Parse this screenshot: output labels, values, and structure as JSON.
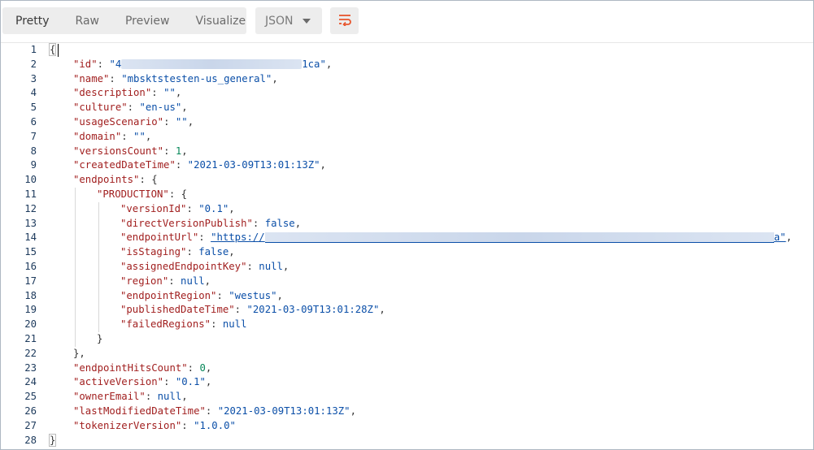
{
  "tabs": {
    "pretty": "Pretty",
    "raw": "Raw",
    "preview": "Preview",
    "visualize": "Visualize",
    "active": "Pretty"
  },
  "format": {
    "selected": "JSON"
  },
  "icons": {
    "wrap": "wrap-lines-icon",
    "dropdown": "chevron-down-icon"
  },
  "colors": {
    "key": "#a11f1f",
    "string": "#0b4fa8",
    "number": "#09885a",
    "wrap_icon": "#e8552d"
  },
  "json_lines": [
    {
      "no": "1",
      "indent": 0,
      "key": "",
      "val": "{",
      "vt": "p",
      "tail": ""
    },
    {
      "no": "2",
      "indent": 1,
      "key": "\"id\"",
      "val": "\"4",
      "vt": "s",
      "redact": "wide1",
      "after": "1ca\"",
      "tail": ","
    },
    {
      "no": "3",
      "indent": 1,
      "key": "\"name\"",
      "val": "\"mbsktstesten-us_general\"",
      "vt": "s",
      "tail": ","
    },
    {
      "no": "4",
      "indent": 1,
      "key": "\"description\"",
      "val": "\"\"",
      "vt": "s",
      "tail": ","
    },
    {
      "no": "5",
      "indent": 1,
      "key": "\"culture\"",
      "val": "\"en-us\"",
      "vt": "s",
      "tail": ","
    },
    {
      "no": "6",
      "indent": 1,
      "key": "\"usageScenario\"",
      "val": "\"\"",
      "vt": "s",
      "tail": ","
    },
    {
      "no": "7",
      "indent": 1,
      "key": "\"domain\"",
      "val": "\"\"",
      "vt": "s",
      "tail": ","
    },
    {
      "no": "8",
      "indent": 1,
      "key": "\"versionsCount\"",
      "val": "1",
      "vt": "n",
      "tail": ","
    },
    {
      "no": "9",
      "indent": 1,
      "key": "\"createdDateTime\"",
      "val": "\"2021-03-09T13:01:13Z\"",
      "vt": "s",
      "tail": ","
    },
    {
      "no": "10",
      "indent": 1,
      "key": "\"endpoints\"",
      "val": "{",
      "vt": "p",
      "tail": ""
    },
    {
      "no": "11",
      "indent": 2,
      "key": "\"PRODUCTION\"",
      "val": "{",
      "vt": "p",
      "tail": ""
    },
    {
      "no": "12",
      "indent": 3,
      "key": "\"versionId\"",
      "val": "\"0.1\"",
      "vt": "s",
      "tail": ","
    },
    {
      "no": "13",
      "indent": 3,
      "key": "\"directVersionPublish\"",
      "val": "false",
      "vt": "kw",
      "tail": ","
    },
    {
      "no": "14",
      "indent": 3,
      "key": "\"endpointUrl\"",
      "val": "\"https://",
      "vt": "s",
      "link": true,
      "redact": "wide2",
      "after": "a\"",
      "tail": ","
    },
    {
      "no": "15",
      "indent": 3,
      "key": "\"isStaging\"",
      "val": "false",
      "vt": "kw",
      "tail": ","
    },
    {
      "no": "16",
      "indent": 3,
      "key": "\"assignedEndpointKey\"",
      "val": "null",
      "vt": "kw",
      "tail": ","
    },
    {
      "no": "17",
      "indent": 3,
      "key": "\"region\"",
      "val": "null",
      "vt": "kw",
      "tail": ","
    },
    {
      "no": "18",
      "indent": 3,
      "key": "\"endpointRegion\"",
      "val": "\"westus\"",
      "vt": "s",
      "tail": ","
    },
    {
      "no": "19",
      "indent": 3,
      "key": "\"publishedDateTime\"",
      "val": "\"2021-03-09T13:01:28Z\"",
      "vt": "s",
      "tail": ","
    },
    {
      "no": "20",
      "indent": 3,
      "key": "\"failedRegions\"",
      "val": "null",
      "vt": "kw",
      "tail": ""
    },
    {
      "no": "21",
      "indent": 2,
      "key": "",
      "val": "}",
      "vt": "p",
      "tail": ""
    },
    {
      "no": "22",
      "indent": 1,
      "key": "",
      "val": "}",
      "vt": "p",
      "tail": ","
    },
    {
      "no": "23",
      "indent": 1,
      "key": "\"endpointHitsCount\"",
      "val": "0",
      "vt": "n",
      "tail": ","
    },
    {
      "no": "24",
      "indent": 1,
      "key": "\"activeVersion\"",
      "val": "\"0.1\"",
      "vt": "s",
      "tail": ","
    },
    {
      "no": "25",
      "indent": 1,
      "key": "\"ownerEmail\"",
      "val": "null",
      "vt": "kw",
      "tail": ","
    },
    {
      "no": "26",
      "indent": 1,
      "key": "\"lastModifiedDateTime\"",
      "val": "\"2021-03-09T13:01:13Z\"",
      "vt": "s",
      "tail": ","
    },
    {
      "no": "27",
      "indent": 1,
      "key": "\"tokenizerVersion\"",
      "val": "\"1.0.0\"",
      "vt": "s",
      "tail": ""
    },
    {
      "no": "28",
      "indent": 0,
      "key": "",
      "val": "}",
      "vt": "p",
      "tail": ""
    }
  ]
}
